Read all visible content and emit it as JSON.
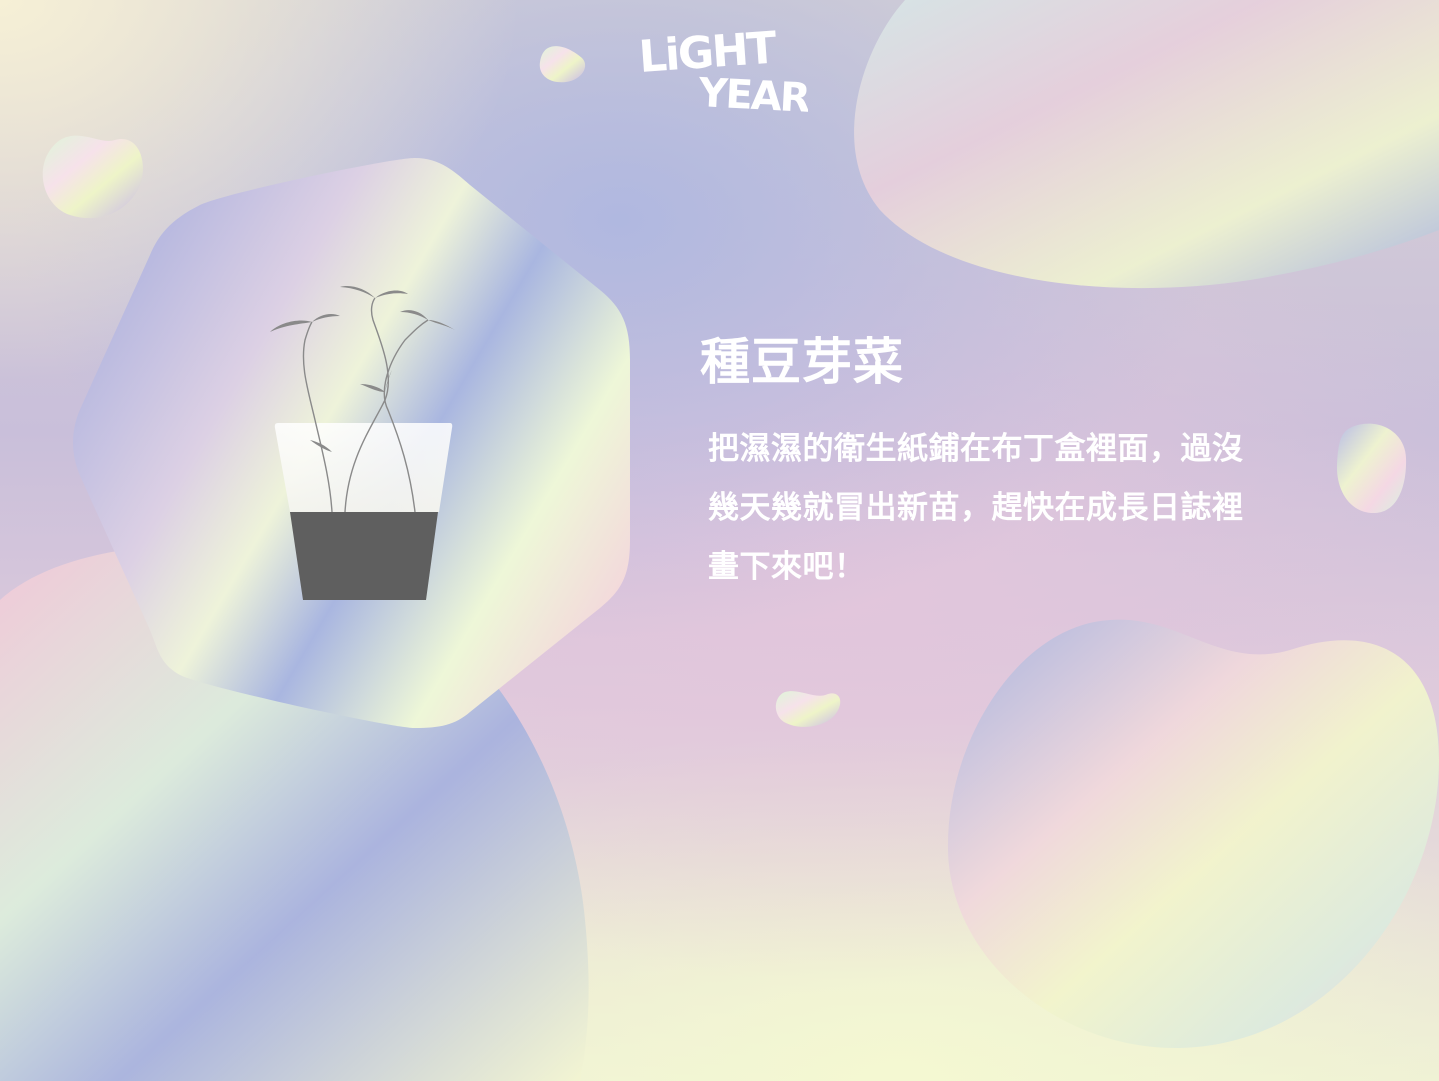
{
  "brand": {
    "logo_line1": "LiGHT",
    "logo_line2": "YEAR",
    "logo_color": "#ffffff"
  },
  "main": {
    "title": "種豆芽菜",
    "description": "把濕濕的衛生紙鋪在布丁盒裡面，過沒幾天幾就冒出新苗，趕快在成長日誌裡畫下來吧！"
  },
  "illustration": {
    "icon": "sprout-in-pot-icon"
  },
  "colors": {
    "text": "#ffffff",
    "soil": "#5f5f5f",
    "cup": "#f7f7f2",
    "leaves": "#8a8a8a",
    "pastel_yellow": "#f2f7d2",
    "pastel_blue": "#a8b4e0",
    "pastel_pink": "#f0c8d8"
  }
}
